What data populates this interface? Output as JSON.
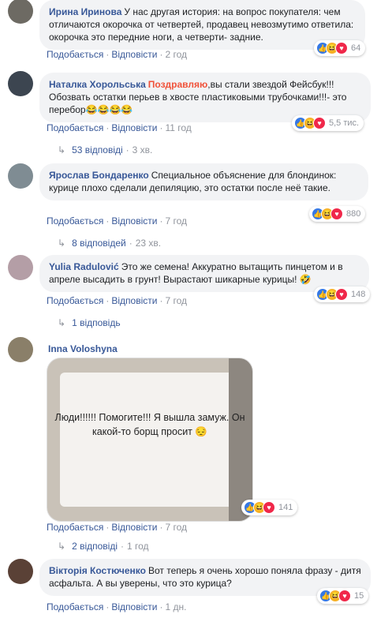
{
  "labels": {
    "like": "Подобається",
    "reply": "Відповісти",
    "sep": "·"
  },
  "comments": [
    {
      "author": "Ирина Иринова",
      "text": "У нас другая история: на вопрос покупателя: чем отличаются окорочка от четвертей, продавец невозмутимо ответила: окорочка это передние ноги, а четверти- задние.",
      "time": "2 год",
      "reactions": "64",
      "avatar_color": "#6d6a63"
    },
    {
      "author": "Наталка Хорольська",
      "mention": "Поздравляю",
      "text": ",вы стали звездой Фейсбук!!! Обозвать остатки перьев в хвосте пластиковыми трубочками!!!- это перебор",
      "emoji": "😂😂😂😂",
      "time": "11 год",
      "reactions": "5,5 тис.",
      "replies_label": "53 відповіді",
      "replies_time": "3 хв.",
      "avatar_color": "#3c4550"
    },
    {
      "author": "Ярослав Бондаренко",
      "text": "Специальное объяснение для блондинок: курице плохо сделали депиляцию, это остатки после неё такие.",
      "time": "7 год",
      "reactions": "880",
      "replies_label": "8 відповідей",
      "replies_time": "23 хв.",
      "avatar_color": "#7f8c93"
    },
    {
      "author": "Yulia Radulović",
      "text": "Это же семена! Аккуратно вытащить пинцетом и в апреле высадить в грунт! Вырастают шикарные курицы!",
      "emoji": "🤣",
      "time": "7 год",
      "reactions": "148",
      "replies_label": "1 відповідь",
      "avatar_color": "#b49ea6"
    },
    {
      "author": "Inna Voloshyna",
      "photo_text": "Люди!!!!!! Помогите!!! Я вышла замуж. Он какой-то борщ просит 😔",
      "time": "7 год",
      "reactions": "141",
      "replies_label": "2 відповіді",
      "replies_time": "1 год",
      "avatar_color": "#8a7f69"
    },
    {
      "author": "Вікторія Костюченко",
      "text": "Вот теперь я очень хорошо поняла фразу - дитя асфальта. А вы уверены, что это курица?",
      "time": "1 дн.",
      "reactions": "15",
      "avatar_color": "#5a4136"
    }
  ]
}
